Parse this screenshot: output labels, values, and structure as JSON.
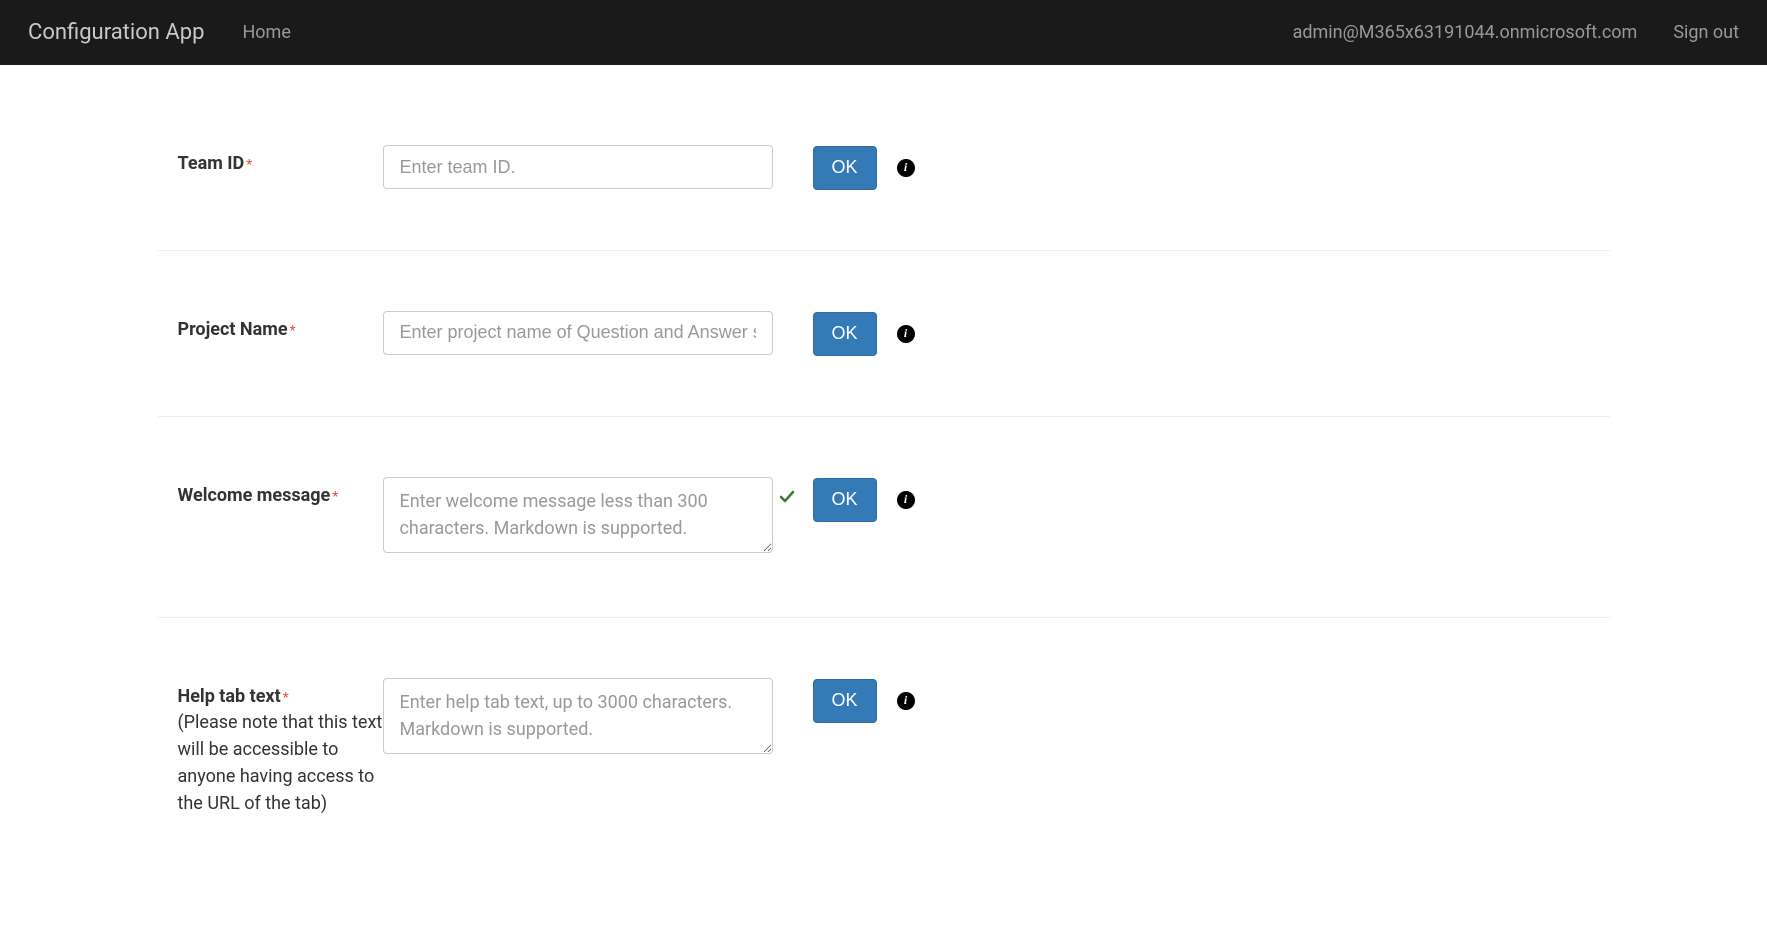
{
  "navbar": {
    "brand": "Configuration App",
    "home": "Home",
    "user_email": "admin@M365x63191044.onmicrosoft.com",
    "signout": "Sign out"
  },
  "fields": {
    "team_id": {
      "label": "Team ID",
      "placeholder": "Enter team ID.",
      "ok": "OK"
    },
    "project_name": {
      "label": "Project Name",
      "placeholder": "Enter project name of Question and Answer service.",
      "ok": "OK"
    },
    "welcome_message": {
      "label": "Welcome message",
      "placeholder": "Enter welcome message less than 300 characters. Markdown is supported.",
      "ok": "OK"
    },
    "help_tab": {
      "label": "Help tab text",
      "note": "(Please note that this text will be accessible to anyone having access to the URL of the tab)",
      "placeholder": "Enter help tab text, up to 3000 characters. Markdown is supported.",
      "ok": "OK"
    }
  }
}
